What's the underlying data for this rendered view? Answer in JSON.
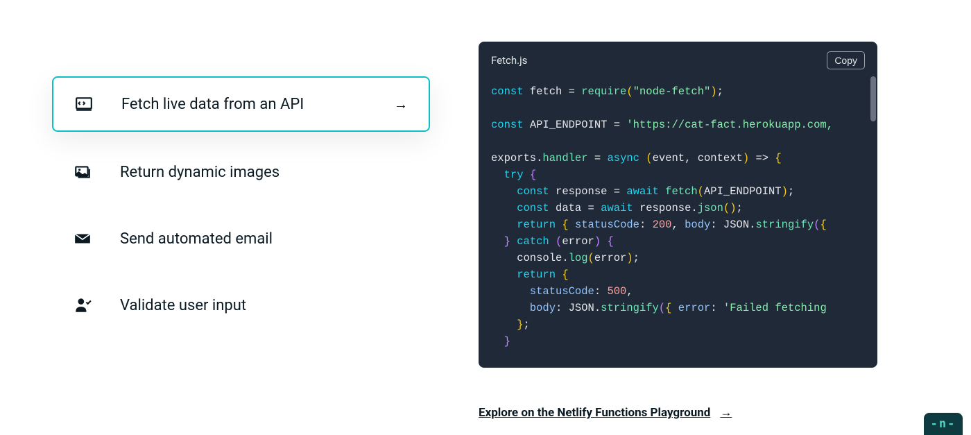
{
  "options": {
    "fetch": {
      "label": "Fetch live data from an API"
    },
    "images": {
      "label": "Return dynamic images"
    },
    "email": {
      "label": "Send automated email"
    },
    "validate": {
      "label": "Validate user input"
    }
  },
  "code": {
    "filename": "Fetch.js",
    "copy_label": "Copy",
    "tokens": {
      "l1_const": "const",
      "l1_fetch": " fetch ",
      "l1_eq": "= ",
      "l1_require": "require",
      "l1_paren_o": "(",
      "l1_str": "\"node-fetch\"",
      "l1_paren_c": ")",
      "l1_semi": ";",
      "l3_const": "const",
      "l3_api": " API_ENDPOINT ",
      "l3_eq": "= ",
      "l3_str": "'https://cat-fact.herokuapp.com,",
      "l5_exports": "exports.",
      "l5_handler": "handler",
      "l5_sp": " ",
      "l5_eq": "= ",
      "l5_async": "async ",
      "l5_paren_o": "(",
      "l5_args": "event, context",
      "l5_paren_c": ")",
      "l5_arrow": " => ",
      "l5_brace": "{",
      "l6_try": "  try ",
      "l6_brace": "{",
      "l7_const": "    const",
      "l7_resp": " response ",
      "l7_eq": "= ",
      "l7_await": "await ",
      "l7_fetch": "fetch",
      "l7_paren_o": "(",
      "l7_arg": "API_ENDPOINT",
      "l7_paren_c": ")",
      "l7_semi": ";",
      "l8_const": "    const",
      "l8_data": " data ",
      "l8_eq": "= ",
      "l8_await": "await ",
      "l8_resp": "response.",
      "l8_json": "json",
      "l8_paren_o": "(",
      "l8_paren_c": ")",
      "l8_semi": ";",
      "l9_return": "    return ",
      "l9_brace_o": "{",
      "l9_sp1": " ",
      "l9_status": "statusCode",
      "l9_colon1": ": ",
      "l9_200": "200",
      "l9_comma": ", ",
      "l9_body": "body",
      "l9_colon2": ": ",
      "l9_json_o": "JSON.",
      "l9_stringify": "stringify",
      "l9_paren_o": "(",
      "l9_brace2": "{",
      "l10_brace_c": "  }",
      "l10_sp": " ",
      "l10_catch": "catch ",
      "l10_paren_o": "(",
      "l10_err": "error",
      "l10_paren_c": ")",
      "l10_sp2": " ",
      "l10_brace": "{",
      "l11_console": "    console.",
      "l11_log": "log",
      "l11_paren_o": "(",
      "l11_err": "error",
      "l11_paren_c": ")",
      "l11_semi": ";",
      "l12_return": "    return ",
      "l12_brace": "{",
      "l13_status": "      statusCode",
      "l13_colon": ": ",
      "l13_500": "500",
      "l13_comma": ",",
      "l14_body": "      body",
      "l14_colon": ": ",
      "l14_json_o": "JSON.",
      "l14_stringify": "stringify",
      "l14_paren_o": "(",
      "l14_brace": "{",
      "l14_sp": " ",
      "l14_error": "error",
      "l14_colon2": ": ",
      "l14_str": "'Failed fetching",
      "l15_brace": "    }",
      "l15_semi": ";",
      "l16_brace": "  }"
    }
  },
  "explore": {
    "label": "Explore on the Netlify Functions Playground"
  },
  "badge": {
    "text": "-n-"
  }
}
